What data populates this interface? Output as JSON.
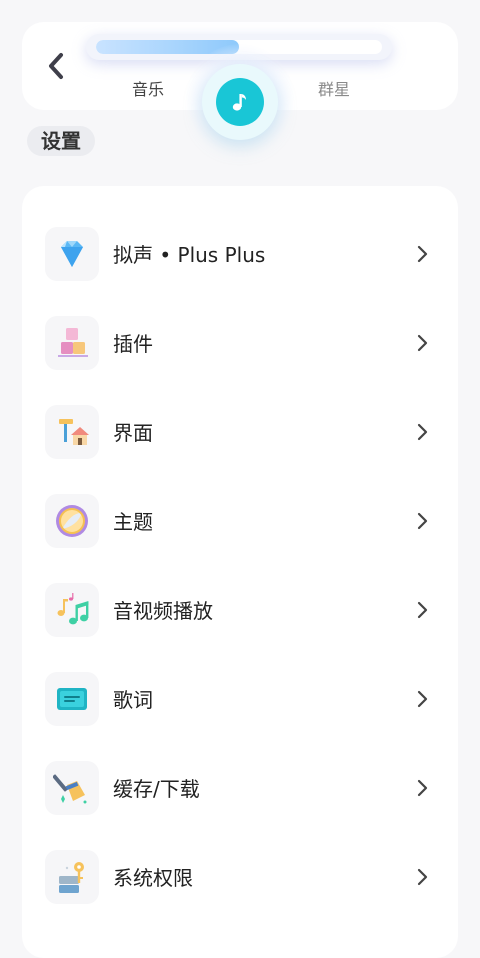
{
  "header": {
    "tab_left": "音乐",
    "tab_right": "群星",
    "progress_fraction": 0.5,
    "accent_color": "#19c6d6"
  },
  "section_title": "设置",
  "settings": {
    "items": [
      {
        "label": "拟声 • Plus Plus",
        "icon": "diamond-icon"
      },
      {
        "label": "插件",
        "icon": "blocks-icon"
      },
      {
        "label": "界面",
        "icon": "paint-house-icon"
      },
      {
        "label": "主题",
        "icon": "theme-palette-icon"
      },
      {
        "label": "音视频播放",
        "icon": "music-notes-icon"
      },
      {
        "label": "歌词",
        "icon": "lyrics-screen-icon"
      },
      {
        "label": "缓存/下载",
        "icon": "broom-icon"
      },
      {
        "label": "系统权限",
        "icon": "key-permission-icon"
      }
    ]
  }
}
